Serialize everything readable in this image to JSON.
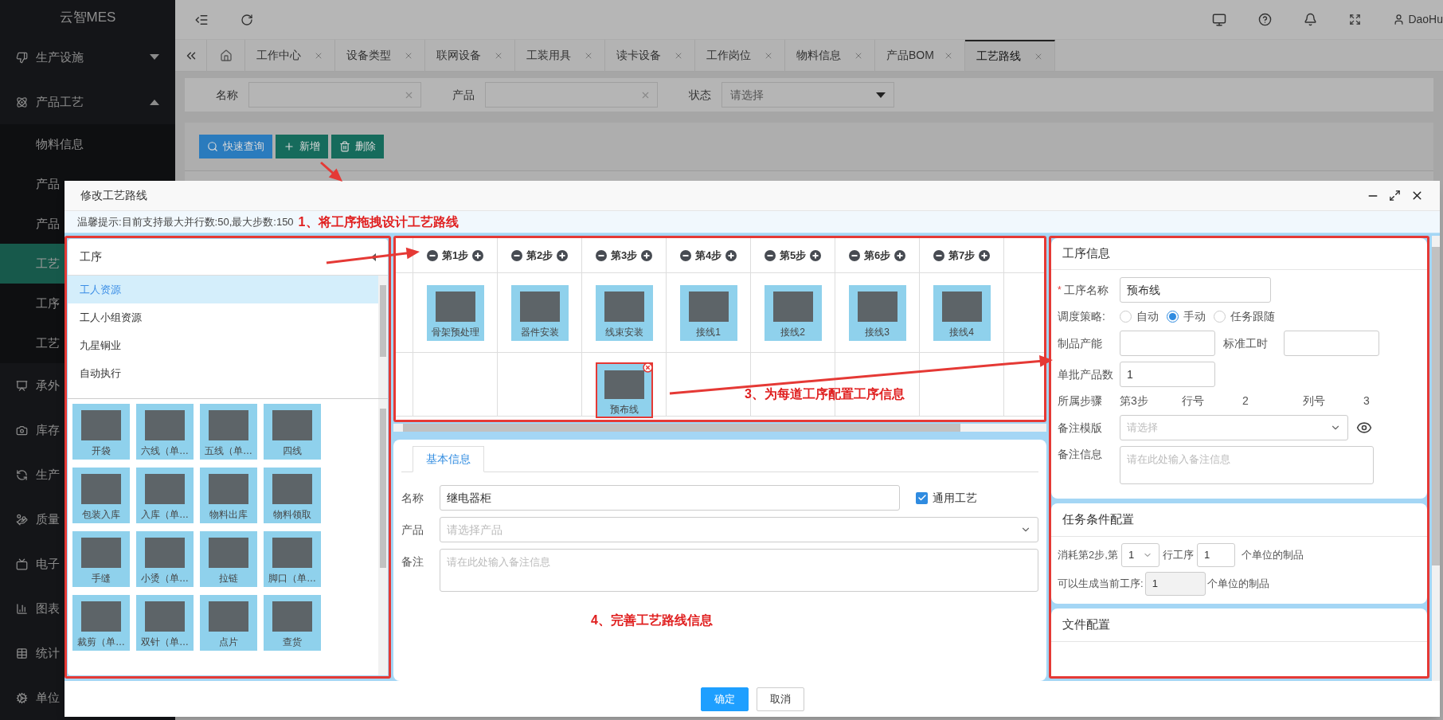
{
  "app": {
    "title": "云智MES",
    "user": "DaoHu"
  },
  "sidebar": {
    "items": [
      {
        "label": "生产设施",
        "expanded": false
      },
      {
        "label": "产品工艺",
        "expanded": true,
        "children": [
          {
            "label": "物料信息",
            "selected": false
          },
          {
            "label": "产品",
            "selected": false
          },
          {
            "label": "产品",
            "selected": false
          },
          {
            "label": "工艺",
            "selected": true
          },
          {
            "label": "工序",
            "selected": false
          },
          {
            "label": "工艺",
            "selected": false
          }
        ]
      },
      {
        "label": "承外"
      },
      {
        "label": "库存"
      },
      {
        "label": "生产"
      },
      {
        "label": "质量"
      },
      {
        "label": "电子"
      },
      {
        "label": "图表"
      },
      {
        "label": "统计"
      },
      {
        "label": "单位"
      }
    ]
  },
  "tabs": [
    {
      "label": "工作中心",
      "selected": false
    },
    {
      "label": "设备类型",
      "selected": false
    },
    {
      "label": "联网设备",
      "selected": false
    },
    {
      "label": "工装用具",
      "selected": false
    },
    {
      "label": "读卡设备",
      "selected": false
    },
    {
      "label": "工作岗位",
      "selected": false
    },
    {
      "label": "物料信息",
      "selected": false
    },
    {
      "label": "产品BOM",
      "selected": false
    },
    {
      "label": "工艺路线",
      "selected": true
    }
  ],
  "filters": [
    {
      "label": "名称",
      "kind": "text"
    },
    {
      "label": "产品",
      "kind": "text"
    },
    {
      "label": "状态",
      "kind": "select",
      "placeholder": "请选择"
    }
  ],
  "toolbar_buttons": [
    {
      "label": "快速查询",
      "kind": "search"
    },
    {
      "label": "新增",
      "kind": "add"
    },
    {
      "label": "删除",
      "kind": "delete"
    }
  ],
  "dialog": {
    "title": "修改工艺路线",
    "hint": "温馨提示:目前支持最大并行数:50,最大步数:150",
    "hint_annotation": "1、将工序拖拽设计工艺路线"
  },
  "left_panel": {
    "title": "工序",
    "categories": [
      {
        "label": "工人资源",
        "selected": true
      },
      {
        "label": "工人小组资源",
        "selected": false
      },
      {
        "label": "九星铜业",
        "selected": false
      },
      {
        "label": "自动执行",
        "selected": false
      }
    ],
    "processes": [
      "开袋",
      "六线（单…",
      "五线（单…",
      "四线",
      "包装入库",
      "入库（单…",
      "物料出库",
      "物料领取",
      "手缝",
      "小烫（单…",
      "拉链",
      "脚口（单…",
      "裁剪（单…",
      "双针（单…",
      "点片",
      "查货"
    ]
  },
  "step_grid": {
    "steps": [
      "第1步",
      "第2步",
      "第3步",
      "第4步",
      "第5步",
      "第6步",
      "第7步"
    ],
    "rows": [
      [
        {
          "label": "骨架预处理",
          "selected": false
        },
        {
          "label": "器件安装",
          "selected": false
        },
        {
          "label": "线束安装",
          "selected": false
        },
        {
          "label": "接线1",
          "selected": false
        },
        {
          "label": "接线2",
          "selected": false
        },
        {
          "label": "接线3",
          "selected": false
        },
        {
          "label": "接线4",
          "selected": false
        }
      ],
      [
        null,
        null,
        {
          "label": "预布线",
          "selected": true
        },
        null,
        null,
        null,
        null
      ]
    ],
    "annotation": "3、为每道工序配置工序信息"
  },
  "basic_info": {
    "tabs": [
      {
        "label": "基本信息",
        "selected": true
      }
    ],
    "name": {
      "label": "名称",
      "value": "继电器柜"
    },
    "general": {
      "label": "通用工艺",
      "checked": true
    },
    "product": {
      "label": "产品",
      "placeholder": "请选择产品"
    },
    "remark": {
      "label": "备注",
      "placeholder": "请在此处输入备注信息"
    },
    "annotation": "4、完善工艺路线信息"
  },
  "process_info": {
    "title": "工序信息",
    "name": {
      "required_mark": "*",
      "label": "工序名称",
      "value": "预布线"
    },
    "strategy": {
      "label": "调度策略:",
      "options": [
        {
          "label": "自动",
          "selected": false
        },
        {
          "label": "手动",
          "selected": true
        },
        {
          "label": "任务跟随",
          "selected": false
        }
      ]
    },
    "capacity": {
      "label": "制品产能"
    },
    "std_time": {
      "label": "标准工时"
    },
    "batch": {
      "label": "单批产品数",
      "value": "1"
    },
    "step": {
      "label": "所属步骤",
      "value": "第3步",
      "row_label": "行号",
      "row": "2",
      "col_label": "列号",
      "col": "3"
    },
    "remark_template": {
      "label": "备注模版",
      "placeholder": "请选择"
    },
    "remark": {
      "label": "备注信息",
      "placeholder": "请在此处输入备注信息"
    }
  },
  "task_config": {
    "title": "任务条件配置",
    "consume_prefix": "消耗第2步,第",
    "row_value": "1",
    "row_suffix": "行工序",
    "qty": "1",
    "unit_1": "个单位的制品",
    "produce_label": "可以生成当前工序:",
    "produce_value": "1",
    "unit_2": "个单位的制品"
  },
  "file_config": {
    "title": "文件配置"
  },
  "footer": {
    "buttons": [
      {
        "label": "确定",
        "kind": "primary"
      },
      {
        "label": "取消",
        "kind": "default"
      }
    ]
  }
}
